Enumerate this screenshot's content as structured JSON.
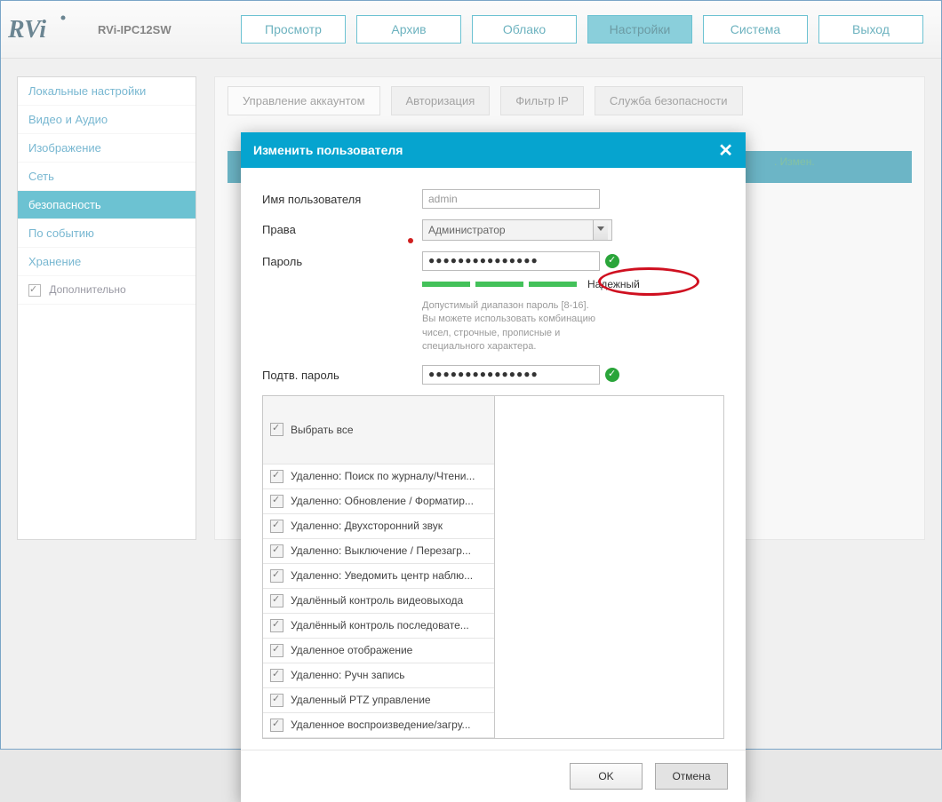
{
  "header": {
    "model": "RVi-IPC12SW",
    "nav": [
      "Просмотр",
      "Архив",
      "Облако",
      "Настройки",
      "Система",
      "Выход"
    ],
    "nav_active_index": 3
  },
  "sidebar": {
    "items": [
      "Локальные настройки",
      "Видео и Аудио",
      "Изображение",
      "Сеть",
      "безопасность",
      "По событию",
      "Хранение"
    ],
    "active_index": 4,
    "extra": {
      "label": "Дополнительно",
      "checked": true
    }
  },
  "tabs": {
    "items": [
      "Управление аккаунтом",
      "Авторизация",
      "Фильтр IP",
      "Служба безопасности"
    ],
    "active_index": 0
  },
  "strip_right": ". Измен.",
  "modal": {
    "title": "Изменить пользователя",
    "labels": {
      "username": "Имя пользователя",
      "rights": "Права",
      "password": "Пароль",
      "confirm": "Подтв. пароль"
    },
    "values": {
      "username": "admin",
      "rights": "Администратор",
      "password_masked": "●●●●●●●●●●●●●●●",
      "confirm_masked": "●●●●●●●●●●●●●●●"
    },
    "strength": {
      "segments": 3,
      "label": "Надежный"
    },
    "hint": "Допустимый диапазон пароль [8-16]. Вы можете использовать комбинацию чисел, строчные, прописные и специального характера.",
    "permissions_header": "Выбрать все",
    "permissions": [
      "Удаленно: Поиск по журналу/Чтени...",
      "Удаленно: Обновление / Форматир...",
      "Удаленно: Двухсторонний звук",
      "Удаленно: Выключение / Перезагр...",
      "Удаленно: Уведомить центр наблю...",
      "Удалённый контроль видеовыхода",
      "Удалённый контроль последовате...",
      "Удаленное отображение",
      "Удаленно: Ручн запись",
      "Удаленный PTZ управление",
      "Удаленное воспроизведение/загру..."
    ],
    "buttons": {
      "ok": "OK",
      "cancel": "Отмена"
    }
  }
}
